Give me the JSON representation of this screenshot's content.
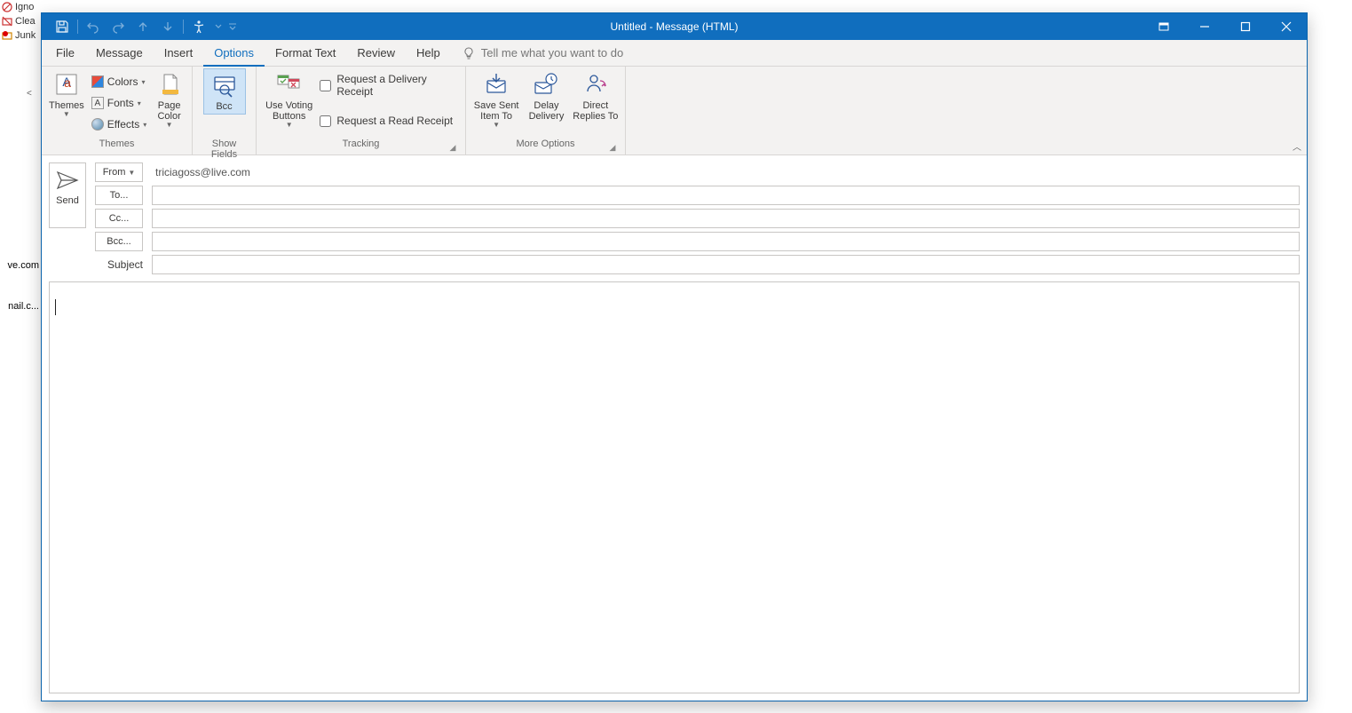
{
  "background": {
    "ignore": "Igno",
    "clean": "Clea",
    "junk": "Junk",
    "live": "ve.com",
    "gmail": "nail.c..."
  },
  "titlebar": {
    "title": "Untitled - Message (HTML)"
  },
  "tabs": {
    "file": "File",
    "message": "Message",
    "insert": "Insert",
    "options": "Options",
    "format_text": "Format Text",
    "review": "Review",
    "help": "Help",
    "tellme": "Tell me what you want to do"
  },
  "ribbon": {
    "themes": {
      "themes_btn": "Themes",
      "colors": "Colors",
      "fonts": "Fonts",
      "effects": "Effects",
      "page_color": "Page Color",
      "group": "Themes"
    },
    "show_fields": {
      "bcc": "Bcc",
      "group": "Show Fields"
    },
    "tracking": {
      "voting": "Use Voting Buttons",
      "delivery": "Request a Delivery Receipt",
      "read": "Request a Read Receipt",
      "group": "Tracking"
    },
    "more": {
      "save_sent": "Save Sent Item To",
      "delay": "Delay Delivery",
      "direct": "Direct Replies To",
      "group": "More Options"
    }
  },
  "header": {
    "send": "Send",
    "from_btn": "From",
    "from_value": "triciagoss@live.com",
    "to": "To...",
    "cc": "Cc...",
    "bcc": "Bcc...",
    "subject": "Subject"
  }
}
